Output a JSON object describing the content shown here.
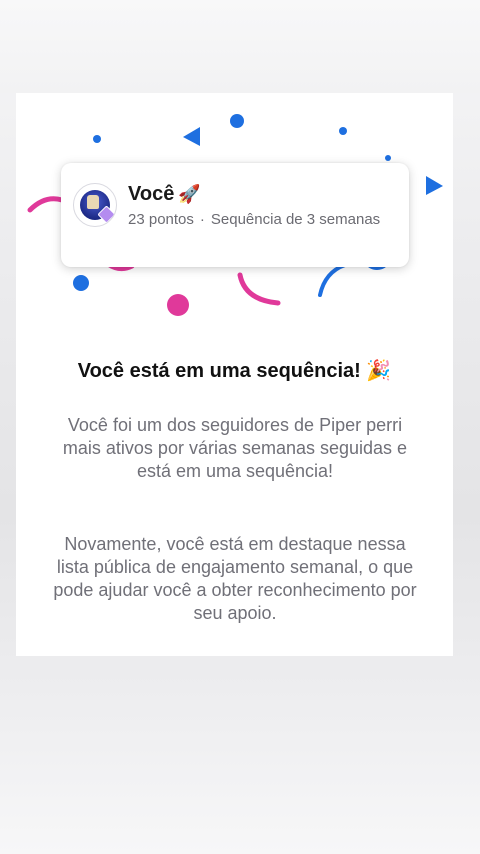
{
  "profile": {
    "name": "Você",
    "name_emoji": "🚀",
    "points": "23 pontos",
    "separator": "·",
    "streak": "Sequência de 3 semanas"
  },
  "headline": {
    "text": "Você está em uma sequência!",
    "emoji": "🎉"
  },
  "paragraphs": {
    "first": "Você foi um dos seguidores de Piper perri mais ativos por várias semanas seguidas e está em uma sequência!",
    "second": "Novamente, você está em destaque nessa lista pública de engajamento semanal, o que pode ajudar você a obter reconhecimento por seu apoio."
  },
  "colors": {
    "confetti_blue": "#1e6fe0",
    "confetti_pink": "#e0399a",
    "card_background": "#ffffff"
  },
  "icons": {
    "avatar": "avatar-icon",
    "rocket": "rocket-emoji",
    "party": "party-popper-emoji"
  }
}
